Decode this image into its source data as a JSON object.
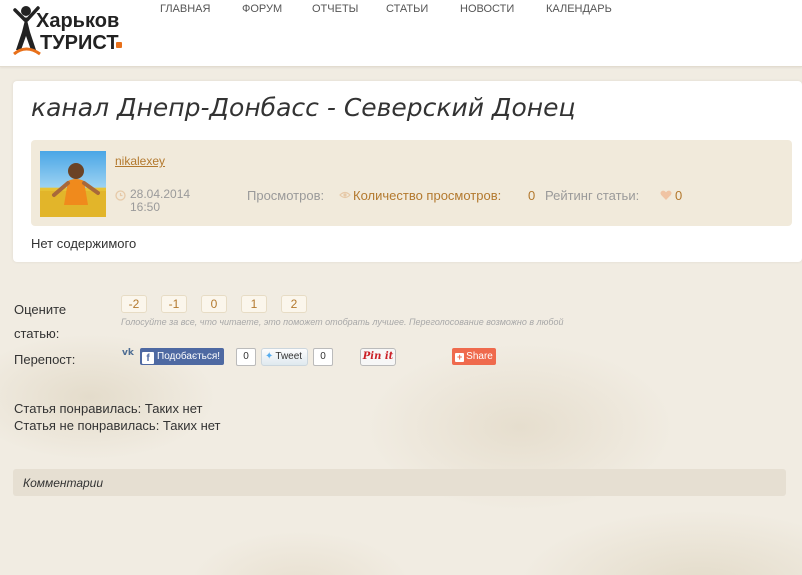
{
  "site": {
    "logo_line1": "Харьков",
    "logo_line2": "ТУРИСТ"
  },
  "nav": {
    "items": [
      {
        "label": "ГЛАВНАЯ"
      },
      {
        "label": "ФОРУМ"
      },
      {
        "label": "ОТЧЕТЫ"
      },
      {
        "label": "СТАТЬИ"
      },
      {
        "label": "НОВОСТИ"
      },
      {
        "label": "КАЛЕНДАРЬ"
      }
    ]
  },
  "article": {
    "title": "канал Днепр-Донбасс - Северский Донец",
    "author": "nikalexey",
    "date": "28.04.2014 16:50",
    "views_label": "Просмотров:",
    "views_link": "Количество просмотров:",
    "views_count": "0",
    "rating_label": "Рейтинг статьи:",
    "rating_value": "0",
    "content": "Нет содержимого"
  },
  "voting": {
    "label": "Оцените статью:",
    "options": [
      "-2",
      "-1",
      "0",
      "1",
      "2"
    ],
    "hint": "Голосуйте за все, что читаете, это поможет отобрать лучшее. Переголосование возможно в любой"
  },
  "share": {
    "label": "Перепост:",
    "vk": "vk",
    "facebook_label": "Подобається!",
    "facebook_count": "0",
    "twitter_label": "Tweet",
    "twitter_count": "0",
    "pinterest_label": "Pin it",
    "share_label": "Share"
  },
  "feedback": {
    "liked": "Статья понравилась: Таких нет",
    "disliked": "Статья не понравилась: Таких нет"
  },
  "comments": {
    "title": "Комментарии"
  },
  "colors": {
    "accent": "#b3792e",
    "logo_orange": "#e8701a",
    "facebook": "#4e69a2",
    "share": "#ef6a4d"
  }
}
